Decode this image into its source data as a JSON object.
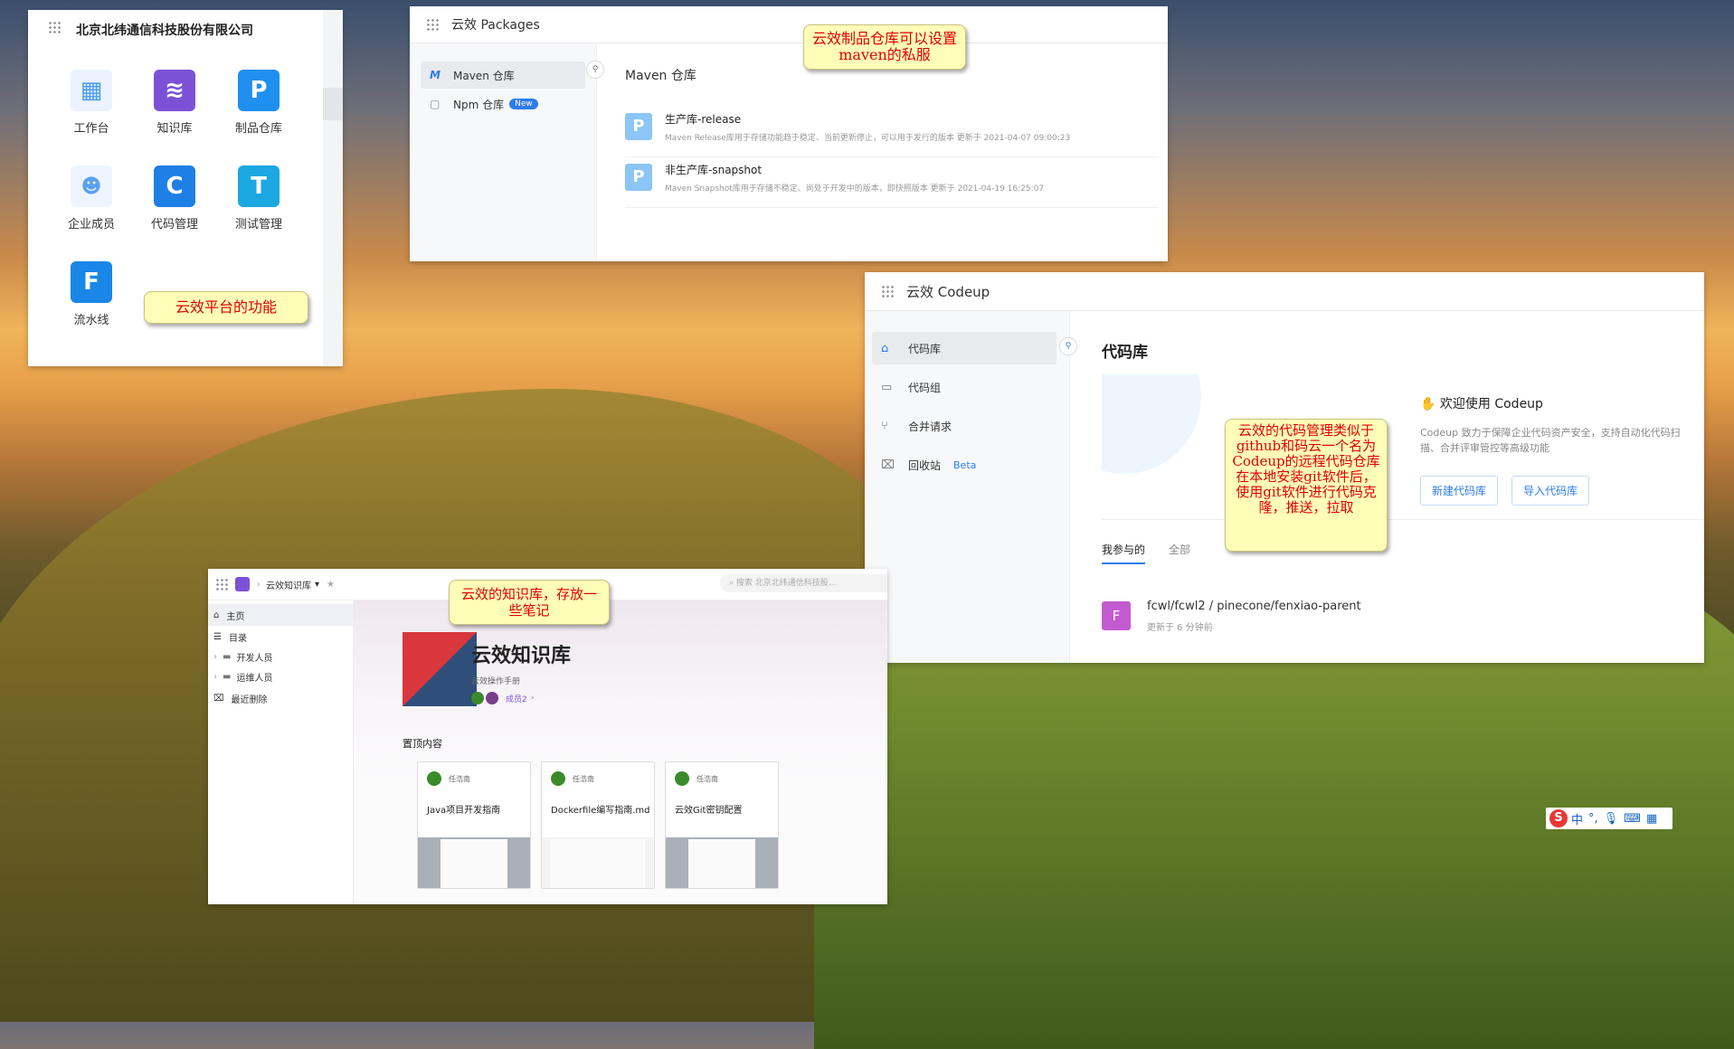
{
  "workspace": {
    "company": "北京北纬通信科技股份有限公司",
    "apps": [
      {
        "label": "工作台",
        "icon": "workbench-icon",
        "glyph": "▦",
        "color": "#5aa0f0"
      },
      {
        "label": "知识库",
        "icon": "knowledge-base-icon",
        "glyph": "≋",
        "color": "#7b52d6"
      },
      {
        "label": "制品仓库",
        "icon": "packages-icon",
        "glyph": "P",
        "color": "#1f8ff0"
      },
      {
        "label": "企业成员",
        "icon": "members-icon",
        "glyph": "👤",
        "color": "#e8f2ff"
      },
      {
        "label": "代码管理",
        "icon": "codeup-icon",
        "glyph": "C",
        "color": "#1e7fe5"
      },
      {
        "label": "测试管理",
        "icon": "testhub-icon",
        "glyph": "T",
        "color": "#1ba7e0"
      },
      {
        "label": "流水线",
        "icon": "flow-icon",
        "glyph": "F",
        "color": "#1a86e8"
      }
    ],
    "note": "云效平台的功能"
  },
  "packages": {
    "title": "云效 Packages",
    "sidebar": [
      {
        "label": "Maven 仓库",
        "icon": "maven-icon",
        "glyph": "M"
      },
      {
        "label": "Npm 仓库",
        "icon": "npm-icon",
        "glyph": "▢",
        "badge": "New"
      }
    ],
    "section_title": "Maven 仓库",
    "repos": [
      {
        "name": "生产库-release",
        "desc": "Maven Release库用于存储功能趋于稳定、当前更新停止，可以用于发行的版本 更新于 2021-04-07 09:00:23"
      },
      {
        "name": "非生产库-snapshot",
        "desc": "Maven Snapshot库用于存储不稳定、尚处于开发中的版本，即快照版本 更新于 2021-04-19 16:25:07"
      }
    ],
    "note": "云效制品仓库可以设置maven的私服"
  },
  "codeup": {
    "title": "云效 Codeup",
    "sidebar": [
      {
        "label": "代码库",
        "icon": "repo-icon",
        "glyph": "⌂"
      },
      {
        "label": "代码组",
        "icon": "folder-icon",
        "glyph": "▭"
      },
      {
        "label": "合并请求",
        "icon": "merge-request-icon",
        "glyph": "⑂"
      },
      {
        "label": "回收站",
        "icon": "trash-icon",
        "glyph": "🗑",
        "badge": "Beta"
      }
    ],
    "page_title": "代码库",
    "welcome_title": "欢迎使用 Codeup",
    "welcome_desc": "Codeup 致力于保障企业代码资产安全，支持自动化代码扫描、合并评审管控等高级功能",
    "buttons": [
      "新建代码库",
      "导入代码库"
    ],
    "tabs": [
      "我参与的",
      "全部"
    ],
    "repo": {
      "avatar": "F",
      "path": "fcwl/fcwl2 / pinecone/fenxiao-parent",
      "updated": "更新于 6 分钟前"
    },
    "note": "云效的代码管理类似于github和码云一个名为Codeup的远程代码仓库在本地安装git软件后，使用git软件进行代码克隆，推送，拉取"
  },
  "knowledge": {
    "breadcrumb": "云效知识库",
    "search_placeholder": "搜索 北京北纬通信科技股...",
    "sidebar": [
      {
        "label": "主页",
        "icon": "home-icon",
        "glyph": "⌂"
      },
      {
        "label": "目录",
        "icon": "catalog-icon",
        "glyph": "☰"
      },
      {
        "label": "开发人员",
        "icon": "folder-icon",
        "glyph": "▬"
      },
      {
        "label": "运维人员",
        "icon": "folder-icon",
        "glyph": "▬"
      },
      {
        "label": "最近删除",
        "icon": "trash-icon",
        "glyph": "🗑"
      }
    ],
    "title": "云效知识库",
    "subtitle": "云效操作手册",
    "members": "成员2",
    "pinned_title": "置顶内容",
    "cards": [
      {
        "author": "任浩南",
        "title": "Java项目开发指南"
      },
      {
        "author": "任浩南",
        "title": "Dockerfile编写指南.md"
      },
      {
        "author": "任浩南",
        "title": "云效Git密钥配置"
      }
    ],
    "note": "云效的知识库，存放一些笔记"
  },
  "taskbar": {
    "ime": "中"
  }
}
